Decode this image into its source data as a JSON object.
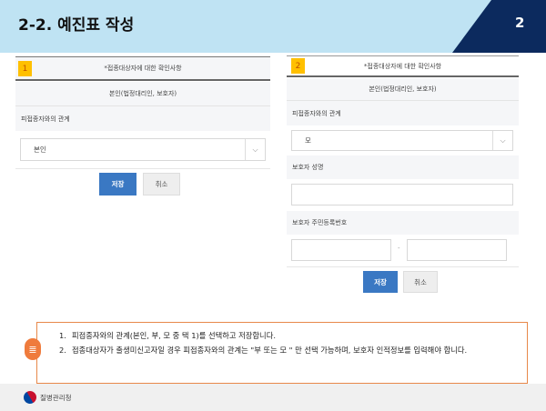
{
  "header": {
    "title": "2-2. 예진표 작성",
    "page_number": "2"
  },
  "panel1": {
    "badge": "1",
    "heading": "*접종대상자에 대한 확인사항",
    "subheading": "본인(법정대리인, 보호자)",
    "relation_label": "피접종자와의 관계",
    "relation_value": "본인",
    "save": "저장",
    "cancel": "취소"
  },
  "panel2": {
    "badge": "2",
    "heading": "*접종대상자에 대한 확인사항",
    "subheading": "본인(법정대리인, 보호자)",
    "relation_label": "피접종자와의 관계",
    "relation_value": "모",
    "guardian_name_label": "보호자 성명",
    "guardian_id_label": "보호자 주민등록번호",
    "id_separator": "-",
    "save": "저장",
    "cancel": "취소"
  },
  "note": {
    "items": [
      {
        "num": "1.",
        "text": "피접종자와의 관계(본인, 부, 모 중 택 1)를 선택하고 저장합니다."
      },
      {
        "num": "2.",
        "text": "접종대상자가 출생미신고자일 경우 피접종자와의 관계는 \"부 또는 모 \" 만 선택 가능하며, 보호자 인적정보를 입력해야 합니다."
      }
    ]
  },
  "footer": {
    "org": "질병관리청"
  }
}
